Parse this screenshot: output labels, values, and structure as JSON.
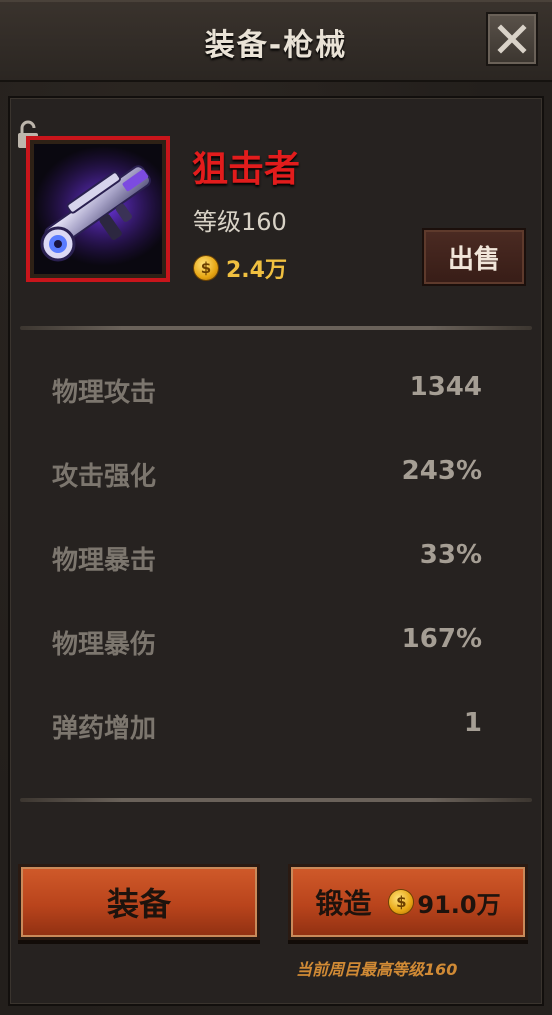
{
  "window": {
    "title": "装备-枪械"
  },
  "item": {
    "name": "狙击者",
    "level_text": "等级160",
    "price_text": "2.4万",
    "coin_symbol": "$",
    "rarity_color": "#c8151b"
  },
  "buttons": {
    "sell_label": "出售",
    "equip_label": "装备",
    "forge_label": "锻造",
    "forge_cost": "91.0万"
  },
  "stats": [
    {
      "label": "物理攻击",
      "value": "1344"
    },
    {
      "label": "攻击强化",
      "value": "243%"
    },
    {
      "label": "物理暴击",
      "value": "33%"
    },
    {
      "label": "物理暴伤",
      "value": "167%"
    },
    {
      "label": "弹药增加",
      "value": "1"
    }
  ],
  "footer": {
    "hint": "当前周目最高等级160"
  }
}
